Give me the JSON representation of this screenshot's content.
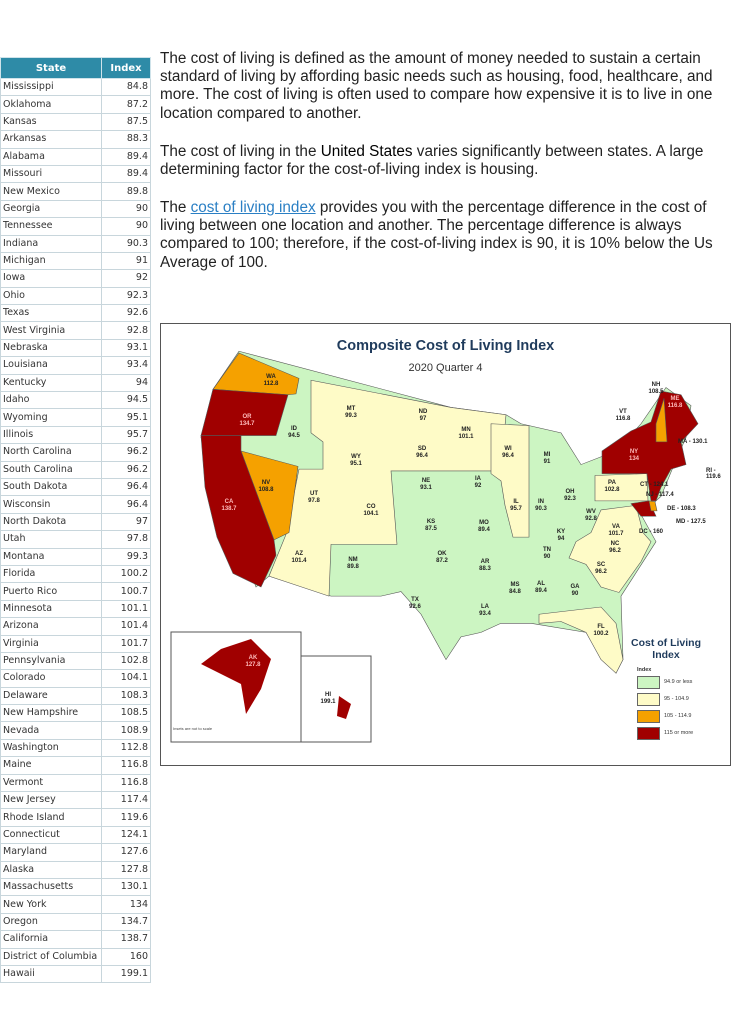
{
  "table": {
    "headers": [
      "State",
      "Index"
    ],
    "rows": [
      [
        "Mississippi",
        "84.8"
      ],
      [
        "Oklahoma",
        "87.2"
      ],
      [
        "Kansas",
        "87.5"
      ],
      [
        "Arkansas",
        "88.3"
      ],
      [
        "Alabama",
        "89.4"
      ],
      [
        "Missouri",
        "89.4"
      ],
      [
        "New Mexico",
        "89.8"
      ],
      [
        "Georgia",
        "90"
      ],
      [
        "Tennessee",
        "90"
      ],
      [
        "Indiana",
        "90.3"
      ],
      [
        "Michigan",
        "91"
      ],
      [
        "Iowa",
        "92"
      ],
      [
        "Ohio",
        "92.3"
      ],
      [
        "Texas",
        "92.6"
      ],
      [
        "West Virginia",
        "92.8"
      ],
      [
        "Nebraska",
        "93.1"
      ],
      [
        "Louisiana",
        "93.4"
      ],
      [
        "Kentucky",
        "94"
      ],
      [
        "Idaho",
        "94.5"
      ],
      [
        "Wyoming",
        "95.1"
      ],
      [
        "Illinois",
        "95.7"
      ],
      [
        "North Carolina",
        "96.2"
      ],
      [
        "South Carolina",
        "96.2"
      ],
      [
        "South Dakota",
        "96.4"
      ],
      [
        "Wisconsin",
        "96.4"
      ],
      [
        "North Dakota",
        "97"
      ],
      [
        "Utah",
        "97.8"
      ],
      [
        "Montana",
        "99.3"
      ],
      [
        "Florida",
        "100.2"
      ],
      [
        "Puerto Rico",
        "100.7"
      ],
      [
        "Minnesota",
        "101.1"
      ],
      [
        "Arizona",
        "101.4"
      ],
      [
        "Virginia",
        "101.7"
      ],
      [
        "Pennsylvania",
        "102.8"
      ],
      [
        "Colorado",
        "104.1"
      ],
      [
        "Delaware",
        "108.3"
      ],
      [
        "New Hampshire",
        "108.5"
      ],
      [
        "Nevada",
        "108.9"
      ],
      [
        "Washington",
        "112.8"
      ],
      [
        "Maine",
        "116.8"
      ],
      [
        "Vermont",
        "116.8"
      ],
      [
        "New Jersey",
        "117.4"
      ],
      [
        "Rhode Island",
        "119.6"
      ],
      [
        "Connecticut",
        "124.1"
      ],
      [
        "Maryland",
        "127.6"
      ],
      [
        "Alaska",
        "127.8"
      ],
      [
        "Massachusetts",
        "130.1"
      ],
      [
        "New York",
        "134"
      ],
      [
        "Oregon",
        "134.7"
      ],
      [
        "California",
        "138.7"
      ],
      [
        "District of Columbia",
        "160"
      ],
      [
        "Hawaii",
        "199.1"
      ]
    ]
  },
  "text": {
    "p1": "The cost of living is defined as the amount of money needed to sustain a certain standard of living by affording basic needs such as housing, food, healthcare, and more. The cost of living is often used to compare how expensive it is to live in one location compared to another.",
    "p2_a": "The cost of living in the ",
    "p2_b": "United States",
    "p2_c": " varies significantly between states. A large determining factor for the cost-of-living index is housing.",
    "p3_a": "The ",
    "p3_link": "cost of living index",
    "p3_b": " provides you with the percentage difference in the cost of living between one location and another. The percentage difference is always compared to 100; therefore, if the cost-of-living index is 90, it is 10% below the Us Average of 100."
  },
  "map": {
    "title": "Composite Cost of Living Index",
    "subtitle": "2020 Quarter 4",
    "legend": {
      "title": "Cost of Living Index",
      "sub": "Index",
      "items": [
        {
          "label": "94.9 or less",
          "color": "#ccf5c2"
        },
        {
          "label": "95 - 104.9",
          "color": "#fefbc7"
        },
        {
          "label": "105 - 114.9",
          "color": "#f5a100"
        },
        {
          "label": "115 or more",
          "color": "#a00000"
        }
      ]
    },
    "note": "Insets are not to scale",
    "states": [
      {
        "a": "WA",
        "v": "112.8"
      },
      {
        "a": "OR",
        "v": "134.7"
      },
      {
        "a": "ID",
        "v": "94.5"
      },
      {
        "a": "MT",
        "v": "99.3"
      },
      {
        "a": "ND",
        "v": "97"
      },
      {
        "a": "MN",
        "v": "101.1"
      },
      {
        "a": "CA",
        "v": "138.7"
      },
      {
        "a": "NV",
        "v": "108.8"
      },
      {
        "a": "UT",
        "v": "97.8"
      },
      {
        "a": "WY",
        "v": "95.1"
      },
      {
        "a": "SD",
        "v": "96.4"
      },
      {
        "a": "CO",
        "v": "104.1"
      },
      {
        "a": "NE",
        "v": "93.1"
      },
      {
        "a": "IA",
        "v": "92"
      },
      {
        "a": "WI",
        "v": "96.4"
      },
      {
        "a": "MI",
        "v": "91"
      },
      {
        "a": "IL",
        "v": "95.7"
      },
      {
        "a": "IN",
        "v": "90.3"
      },
      {
        "a": "OH",
        "v": "92.3"
      },
      {
        "a": "PA",
        "v": "102.8"
      },
      {
        "a": "KS",
        "v": "87.5"
      },
      {
        "a": "MO",
        "v": "89.4"
      },
      {
        "a": "KY",
        "v": "94"
      },
      {
        "a": "WV",
        "v": "92.8"
      },
      {
        "a": "VA",
        "v": "101.7"
      },
      {
        "a": "AZ",
        "v": "101.4"
      },
      {
        "a": "NM",
        "v": "89.8"
      },
      {
        "a": "OK",
        "v": "87.2"
      },
      {
        "a": "AR",
        "v": "88.3"
      },
      {
        "a": "TN",
        "v": "90"
      },
      {
        "a": "NC",
        "v": "96.2"
      },
      {
        "a": "SC",
        "v": "96.2"
      },
      {
        "a": "MS",
        "v": "84.8"
      },
      {
        "a": "AL",
        "v": "89.4"
      },
      {
        "a": "GA",
        "v": "90"
      },
      {
        "a": "TX",
        "v": "92.6"
      },
      {
        "a": "LA",
        "v": "93.4"
      },
      {
        "a": "FL",
        "v": "100.2"
      },
      {
        "a": "NY",
        "v": "134"
      },
      {
        "a": "ME",
        "v": "116.8"
      },
      {
        "a": "NH",
        "v": "108.5"
      },
      {
        "a": "VT",
        "v": "116.8"
      },
      {
        "a": "AK",
        "v": "127.8"
      },
      {
        "a": "HI",
        "v": "199.1"
      }
    ],
    "callouts": [
      "MA - 130.1",
      "RI - 119.6",
      "CT - 124.1",
      "NJ - 117.4",
      "DE - 108.3",
      "MD - 127.5",
      "DC - 160"
    ]
  }
}
